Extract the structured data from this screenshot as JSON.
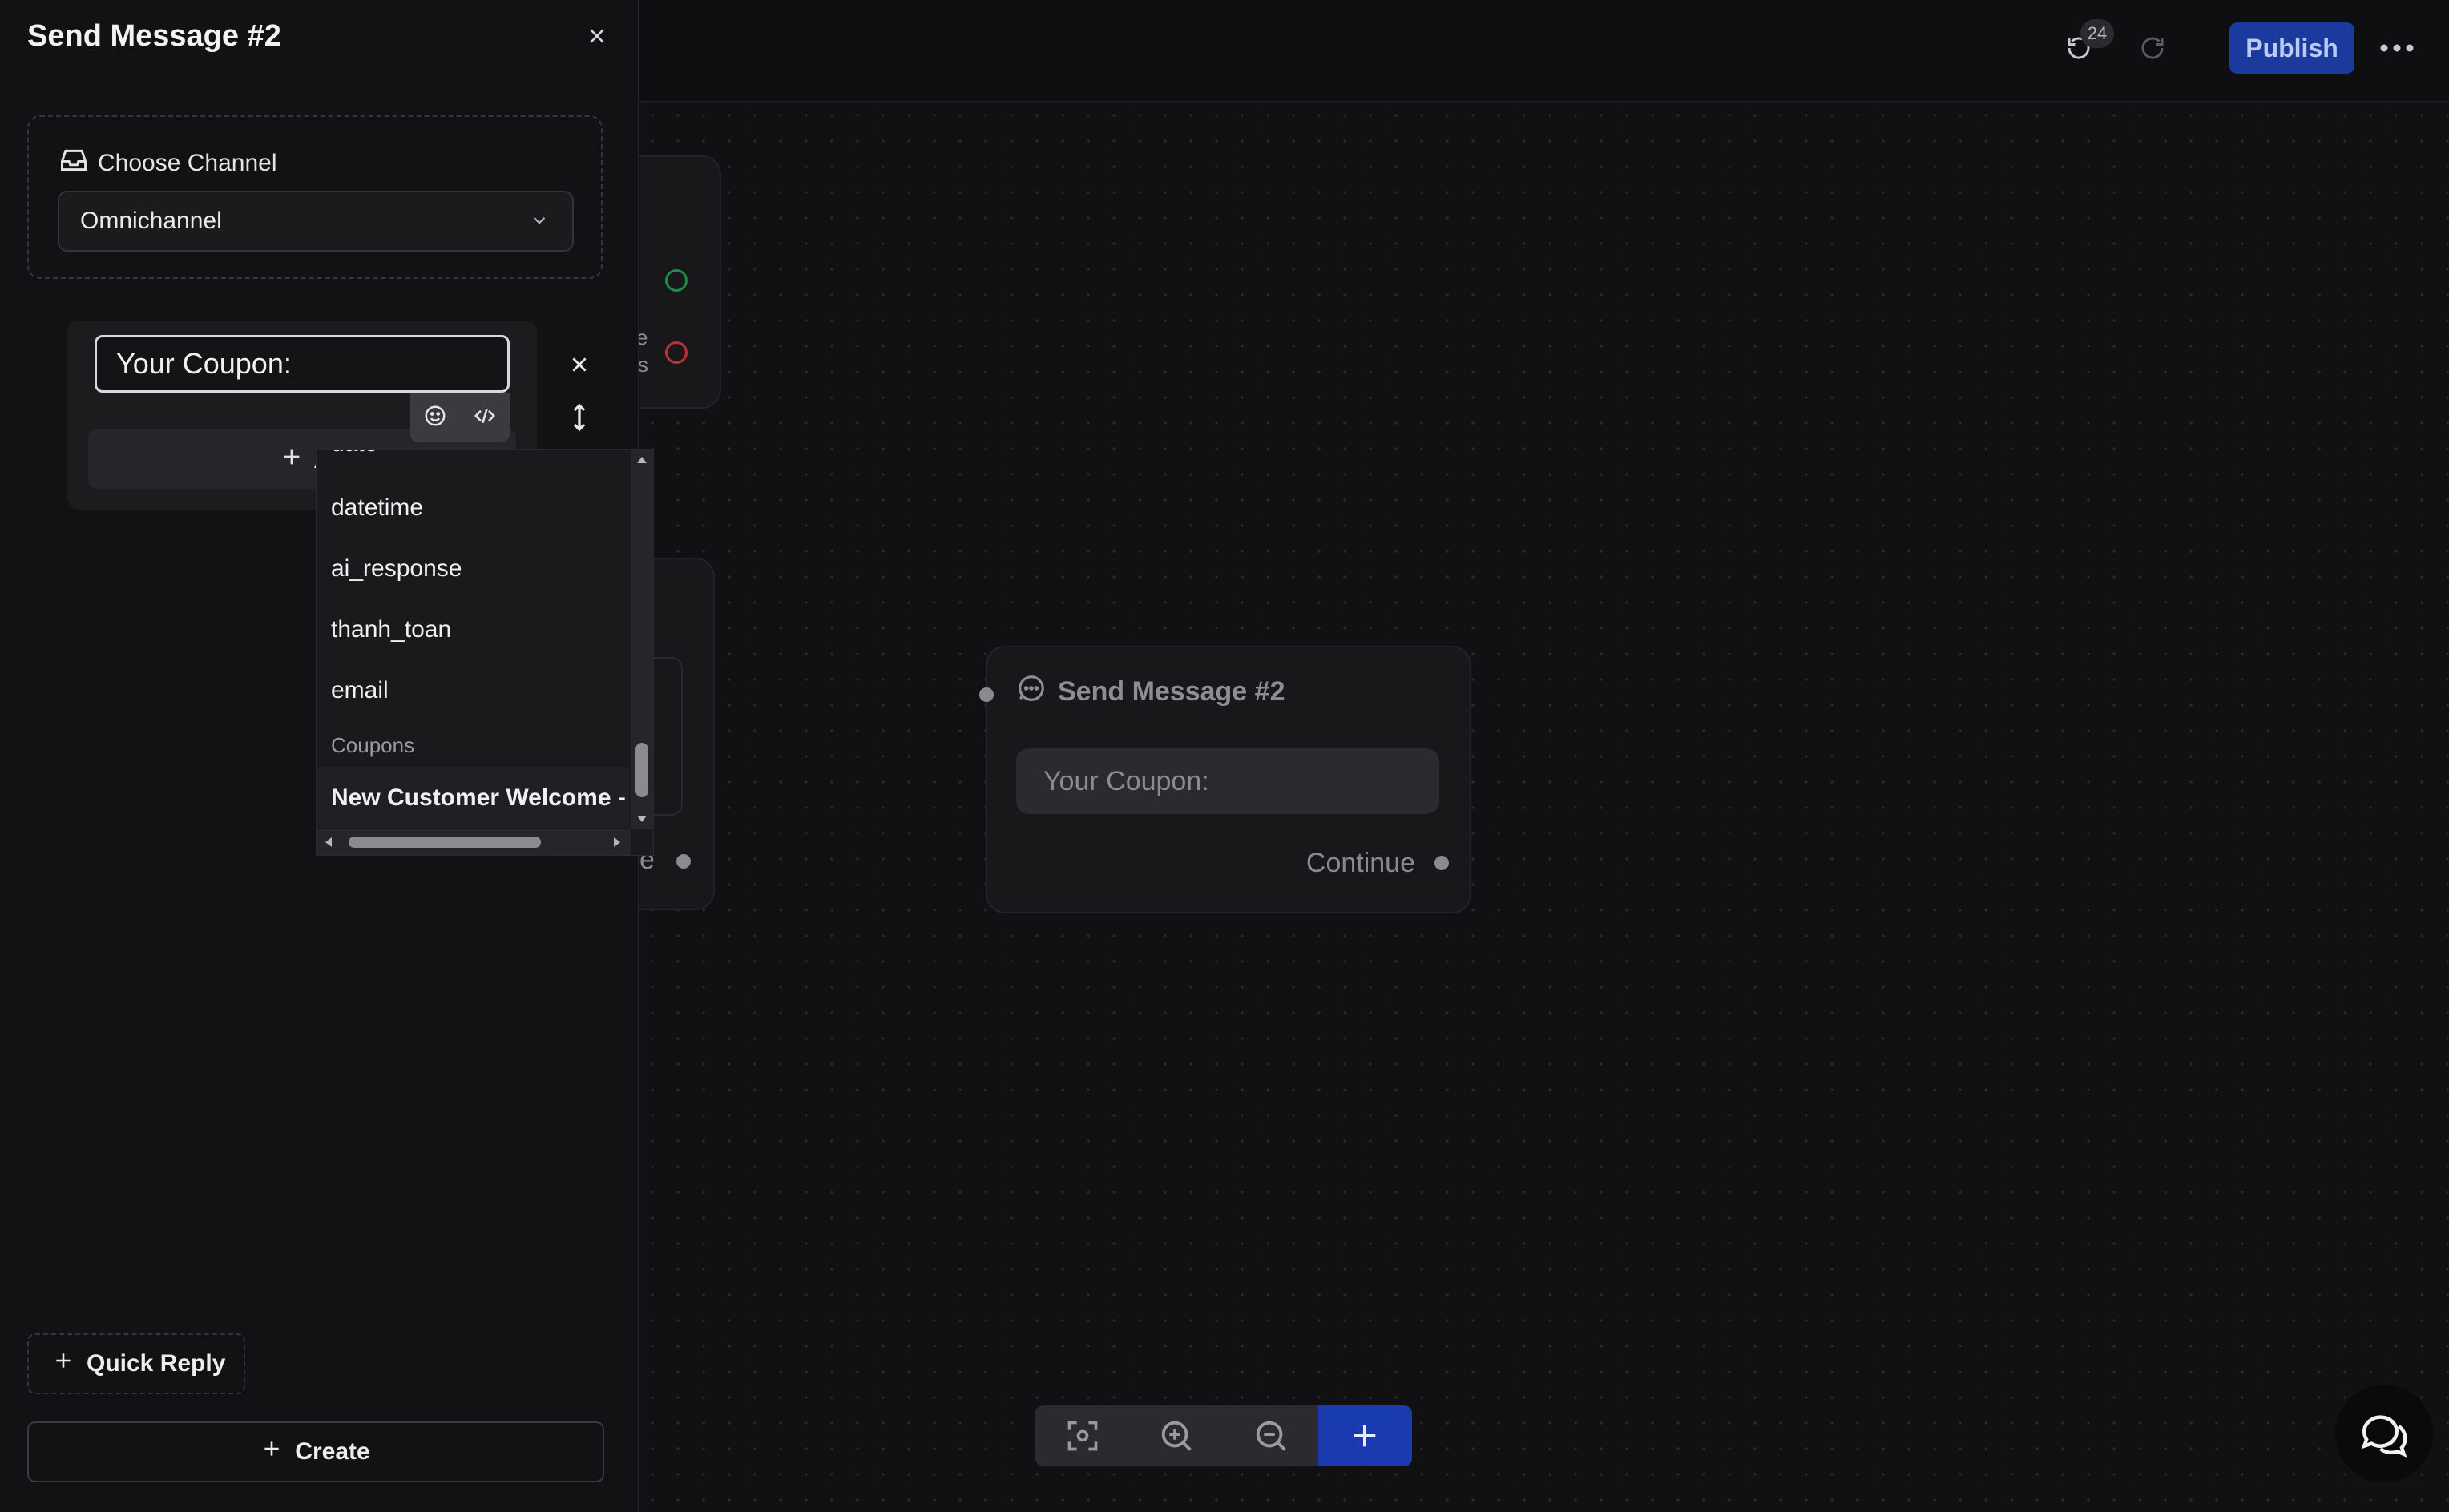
{
  "panel": {
    "title": "Send Message #2",
    "channel_label": "Choose Channel",
    "channel_value": "Omnichannel",
    "message_text": "Your Coupon:",
    "add_button_label": "A",
    "quick_reply_label": "Quick Reply",
    "create_label": "Create"
  },
  "dropdown": {
    "items": [
      "date",
      "datetime",
      "ai_response",
      "thanh_toan",
      "email"
    ],
    "group_label": "Coupons",
    "selected_item": "New Customer Welcome - "
  },
  "topbar": {
    "history_count": "24",
    "publish_label": "Publish"
  },
  "canvas": {
    "node_title": "Send Message #2",
    "node_message": "Your Coupon:",
    "node_continue": "Continue",
    "partial_e_top": "e",
    "partial_s_top": "s",
    "partial_e_bottom": "e"
  },
  "colors": {
    "accent": "#1a3a9e",
    "success_ring": "#1f8a4a",
    "error_ring": "#c0303a"
  }
}
